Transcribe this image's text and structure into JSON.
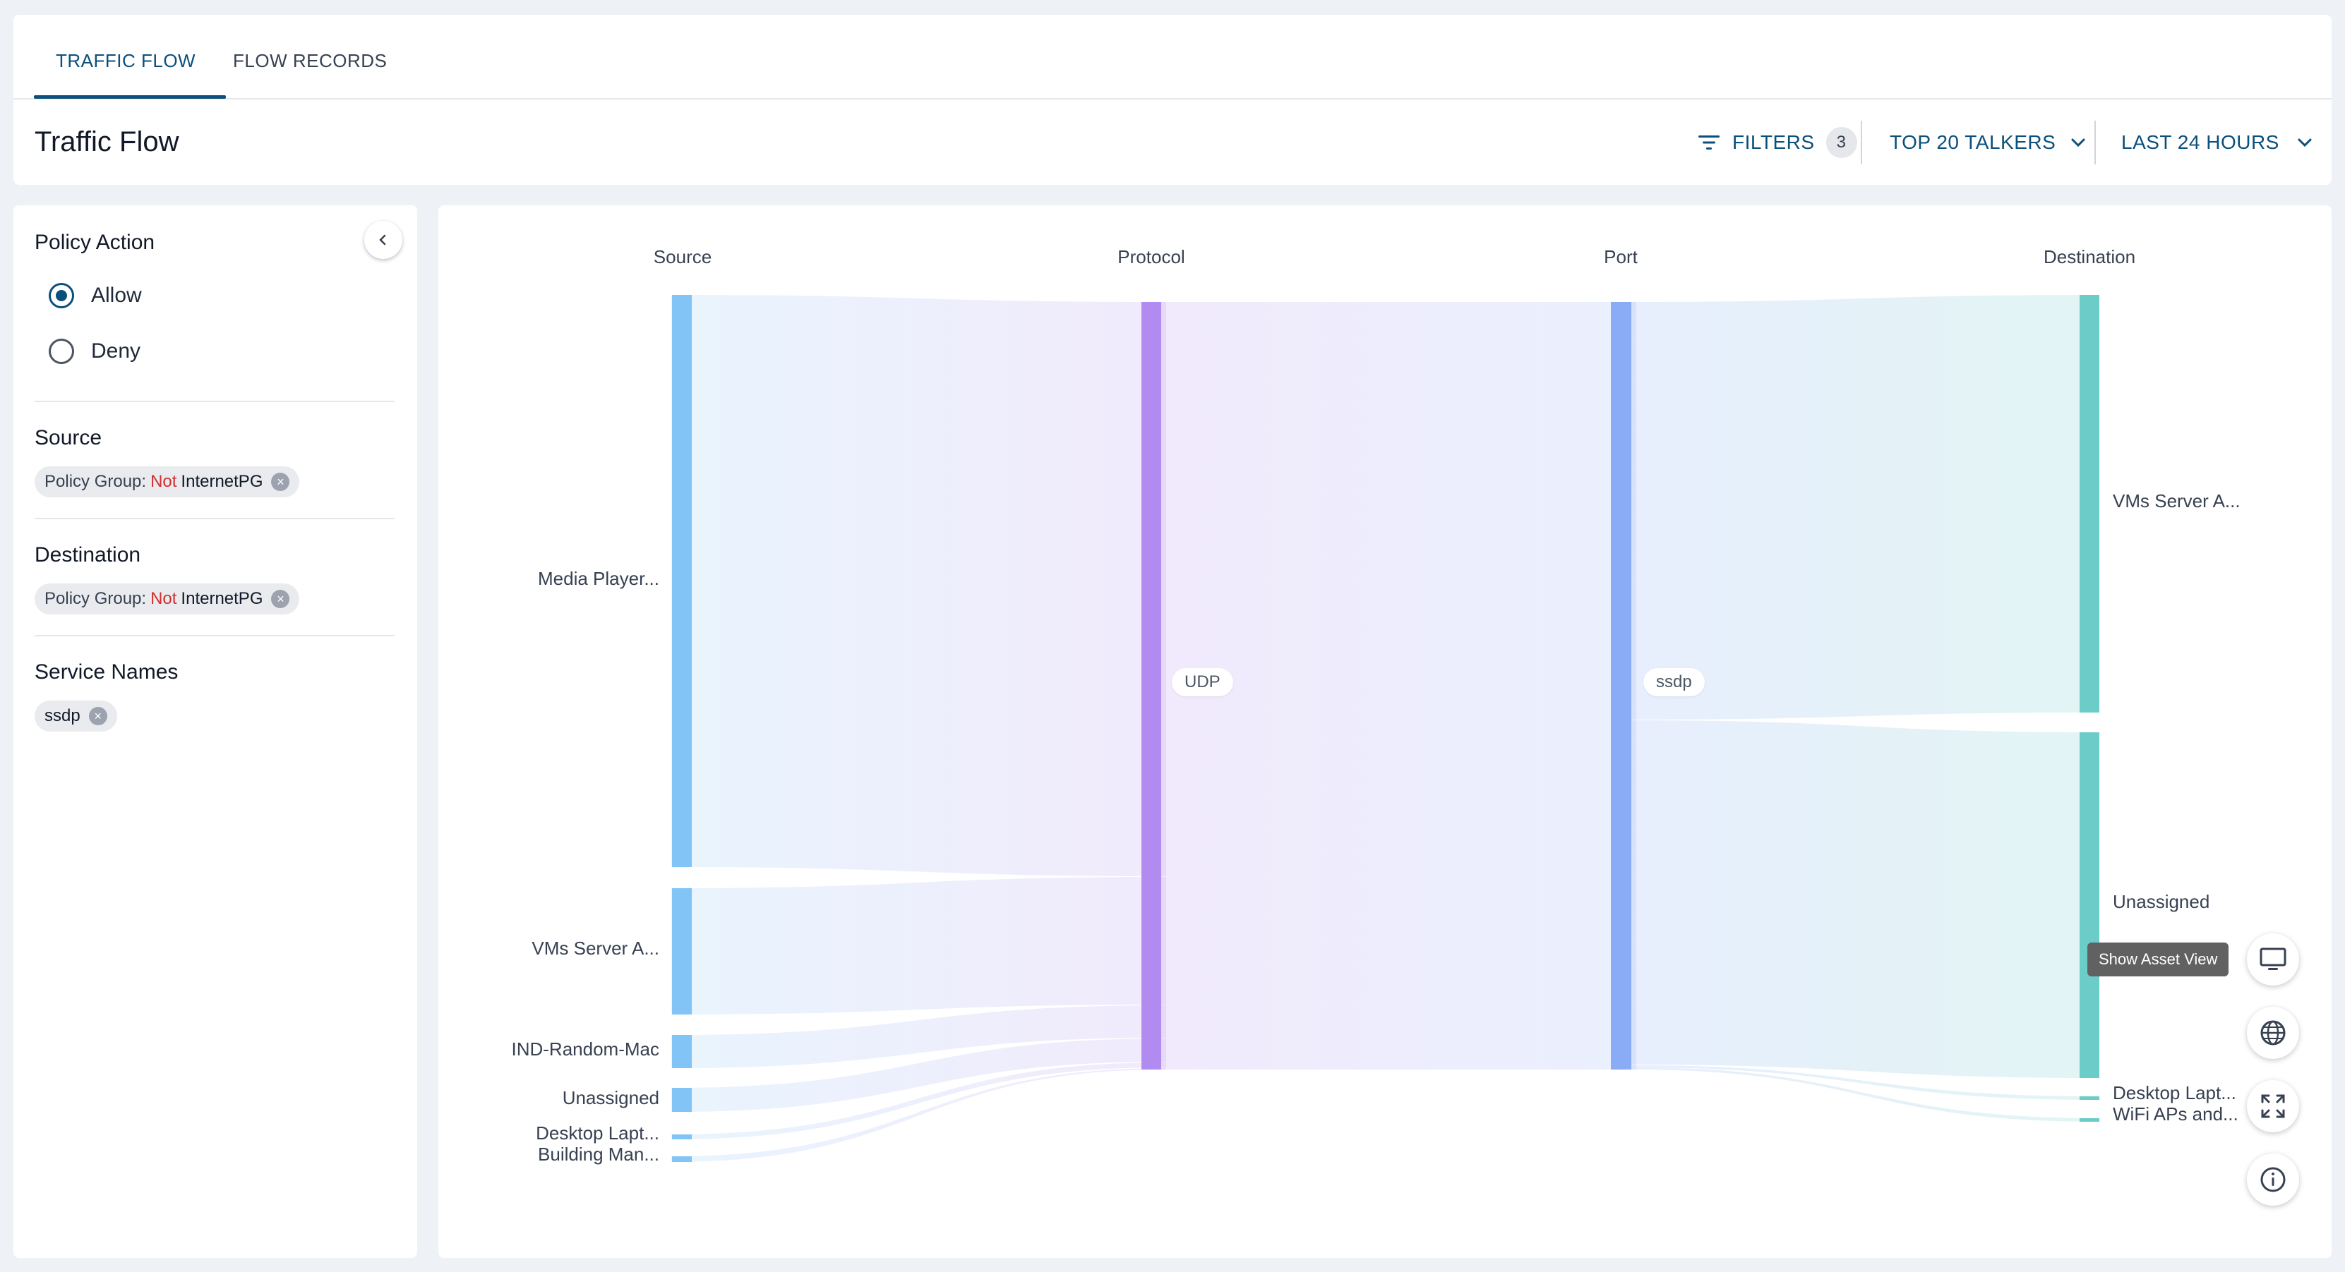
{
  "tabs": [
    {
      "label": "TRAFFIC FLOW"
    },
    {
      "label": "FLOW RECORDS"
    }
  ],
  "page_title": "Traffic Flow",
  "toolbar": {
    "filters_label": "FILTERS",
    "filters_count": "3",
    "talkers_label": "TOP 20 TALKERS",
    "time_label": "LAST 24 HOURS"
  },
  "sidebar": {
    "policy_action": {
      "title": "Policy Action",
      "options": [
        {
          "label": "Allow",
          "selected": true
        },
        {
          "label": "Deny",
          "selected": false
        }
      ]
    },
    "source": {
      "title": "Source",
      "chip": {
        "key": "Policy Group:",
        "op": "Not",
        "value": "InternetPG"
      }
    },
    "destination": {
      "title": "Destination",
      "chip": {
        "key": "Policy Group:",
        "op": "Not",
        "value": "InternetPG"
      }
    },
    "service_names": {
      "title": "Service Names",
      "chip": {
        "value": "ssdp"
      }
    }
  },
  "sankey": {
    "columns": [
      "Source",
      "Protocol",
      "Port",
      "Destination"
    ],
    "source_nodes": [
      "Media Player...",
      "VMs Server A...",
      "IND-Random-Mac",
      "Unassigned",
      "Desktop Lapt...",
      "Building Man..."
    ],
    "protocol_node": "UDP",
    "port_node": "ssdp",
    "destination_nodes": [
      "VMs Server A...",
      "Unassigned",
      "Desktop Lapt...",
      "WiFi APs and..."
    ],
    "colors": {
      "source": "#82c4f5",
      "protocol": "#b28bf0",
      "port": "#8aabf5",
      "destination": "#6cccc8"
    }
  },
  "tooltip": "Show Asset View"
}
